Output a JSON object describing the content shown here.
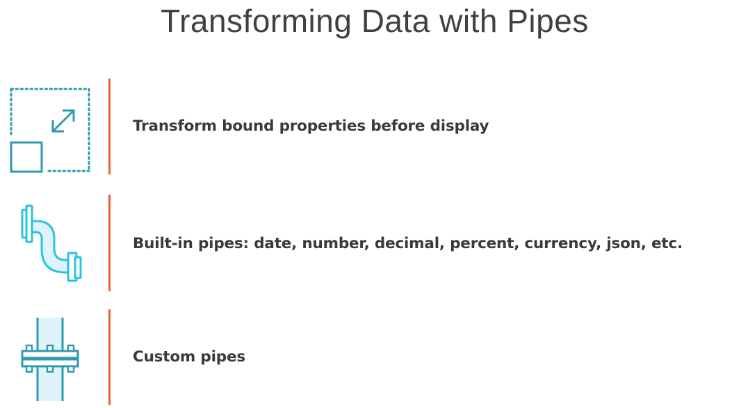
{
  "title": "Transforming Data with Pipes",
  "items": [
    {
      "text": "Transform bound properties before display",
      "icon": "resize-icon"
    },
    {
      "text": "Built-in pipes: date, number, decimal, percent, currency, json, etc.",
      "icon": "bent-pipe-icon"
    },
    {
      "text": "Custom pipes",
      "icon": "pipe-flange-icon"
    }
  ],
  "colors": {
    "accent": "#e8622e",
    "icon_teal": "#2e9ab0",
    "icon_cyan": "#29c3e0",
    "icon_fill": "#dff4fa",
    "text": "#3a3a3a"
  }
}
